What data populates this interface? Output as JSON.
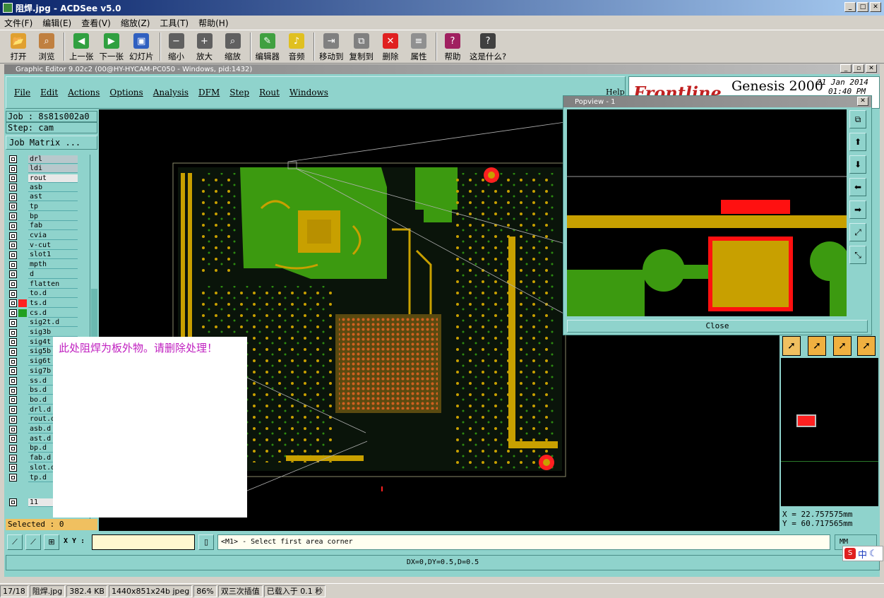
{
  "window": {
    "title": "阻焊.jpg - ACDSee v5.0"
  },
  "menu": [
    "文件(F)",
    "编辑(E)",
    "查看(V)",
    "缩放(Z)",
    "工具(T)",
    "帮助(H)"
  ],
  "toolbar": [
    {
      "label": "打开",
      "icon": "folder-open-icon",
      "color": "#e0a030"
    },
    {
      "label": "浏览",
      "icon": "browse-icon",
      "color": "#c08040"
    },
    {
      "label": "上一张",
      "icon": "arrow-left-icon",
      "color": "#30a040"
    },
    {
      "label": "下一张",
      "icon": "arrow-right-icon",
      "color": "#30a040"
    },
    {
      "label": "幻灯片",
      "icon": "slideshow-icon",
      "color": "#3060c0"
    },
    {
      "label": "缩小",
      "icon": "zoom-out-icon",
      "color": "#606060"
    },
    {
      "label": "放大",
      "icon": "zoom-in-icon",
      "color": "#606060"
    },
    {
      "label": "缩放",
      "icon": "zoom-icon",
      "color": "#606060"
    },
    {
      "label": "编辑器",
      "icon": "editor-icon",
      "color": "#40a040"
    },
    {
      "label": "音频",
      "icon": "audio-icon",
      "color": "#e0c020"
    },
    {
      "label": "移动到",
      "icon": "move-to-icon",
      "color": "#808080"
    },
    {
      "label": "复制到",
      "icon": "copy-to-icon",
      "color": "#808080"
    },
    {
      "label": "删除",
      "icon": "delete-icon",
      "color": "#e02020"
    },
    {
      "label": "属性",
      "icon": "properties-icon",
      "color": "#909090"
    },
    {
      "label": "帮助",
      "icon": "help-book-icon",
      "color": "#a02060"
    },
    {
      "label": "这是什么?",
      "icon": "whats-this-icon",
      "color": "#404040"
    }
  ],
  "editor": {
    "title": "Graphic Editor 9.02c2 (00@HY-HYCAM-PC050 - Windows, pid:1432)",
    "menu": [
      "File",
      "Edit",
      "Actions",
      "Options",
      "Analysis",
      "DFM",
      "Step",
      "Rout",
      "Windows"
    ],
    "help": "Help",
    "brand": "Frontline",
    "product": "Genesis 2000",
    "date": "21 Jan 2014",
    "time": "01:40 PM"
  },
  "job": {
    "job": "Job : 8s81s002a0",
    "step": "Step: cam",
    "matrix": "Job Matrix ..."
  },
  "layers": [
    {
      "name": "drl",
      "style": "grey"
    },
    {
      "name": "ldi",
      "style": "grey"
    },
    {
      "name": "rout",
      "style": "sel"
    },
    {
      "name": "asb",
      "style": ""
    },
    {
      "name": "ast",
      "style": ""
    },
    {
      "name": "tp",
      "style": ""
    },
    {
      "name": "bp",
      "style": ""
    },
    {
      "name": "fab",
      "style": ""
    },
    {
      "name": "cvia",
      "style": ""
    },
    {
      "name": "v-cut",
      "style": ""
    },
    {
      "name": "slot1",
      "style": ""
    },
    {
      "name": "mpth",
      "style": ""
    },
    {
      "name": "d",
      "style": ""
    },
    {
      "name": "flatten",
      "style": ""
    },
    {
      "name": "to.d",
      "style": ""
    },
    {
      "name": "ts.d",
      "style": "",
      "color": "#ff2020"
    },
    {
      "name": "cs.d",
      "style": "",
      "color": "#20a020"
    },
    {
      "name": "sig2t.d",
      "style": ""
    },
    {
      "name": "sig3b",
      "style": ""
    },
    {
      "name": "sig4t",
      "style": ""
    },
    {
      "name": "sig5b",
      "style": ""
    },
    {
      "name": "sig6t",
      "style": ""
    },
    {
      "name": "sig7b",
      "style": ""
    },
    {
      "name": "ss.d",
      "style": ""
    },
    {
      "name": "bs.d",
      "style": ""
    },
    {
      "name": "bo.d",
      "style": ""
    },
    {
      "name": "drl.d",
      "style": ""
    },
    {
      "name": "rout.d",
      "style": ""
    },
    {
      "name": "asb.d",
      "style": ""
    },
    {
      "name": "ast.d",
      "style": ""
    },
    {
      "name": "bp.d",
      "style": ""
    },
    {
      "name": "fab.d",
      "style": ""
    },
    {
      "name": "slot.d",
      "style": ""
    },
    {
      "name": "tp.d",
      "style": ""
    },
    {
      "name": "11",
      "style": "sel"
    }
  ],
  "selected": "Selected : 0",
  "popview": {
    "title": "Popview - 1",
    "close": "Close"
  },
  "note": "此处阻焊为板外物。请删除处理！",
  "coords": {
    "x": "X = 22.757575mm",
    "y": "Y = 60.717565mm"
  },
  "command": {
    "xy_label": "X Y :",
    "prompt": "<M1> - Select first area corner",
    "units": "MM"
  },
  "delta": "DX=0,DY=0.5,D=0.5",
  "status": [
    "17/18",
    "阻焊.jpg",
    "382.4 KB",
    "1440x851x24b jpeg",
    "86%",
    "双三次插值",
    "已载入于 0.1 秒"
  ],
  "ime": {
    "label": "中"
  },
  "colors": {
    "teal": "#8fd3cc",
    "copper": "#c8a000",
    "mask": "#3c9a10",
    "highlight": "#ff2020"
  }
}
